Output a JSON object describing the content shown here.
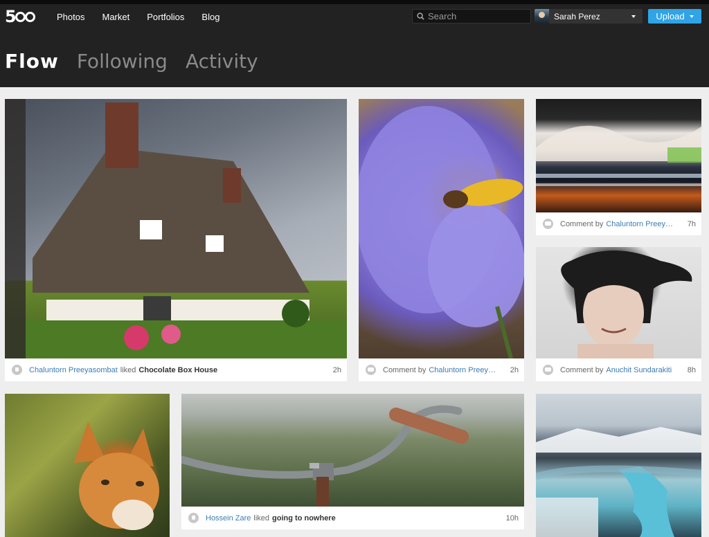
{
  "header": {
    "logo": "5",
    "nav": [
      "Photos",
      "Market",
      "Portfolios",
      "Blog"
    ],
    "search": {
      "placeholder": "Search",
      "icon": "search-icon"
    },
    "user": {
      "name": "Sarah Perez"
    },
    "upload_label": "Upload"
  },
  "tabs": [
    "Flow",
    "Following",
    "Activity"
  ],
  "active_tab": "Flow",
  "cards": [
    {
      "photo": "cottage",
      "icon": "like-icon",
      "who": "Chaluntorn Preeyasombat",
      "verb": "liked",
      "what": "Chocolate Box House",
      "time": "2h"
    },
    {
      "photo": "flower",
      "icon": "comment-icon",
      "verb": "Comment by",
      "who": "Chaluntorn Preeyas...",
      "time": "2h"
    },
    {
      "photo": "night-river",
      "icon": "comment-icon",
      "verb": "Comment by",
      "who": "Chaluntorn Preeyas...",
      "time": "7h"
    },
    {
      "photo": "child",
      "icon": "comment-icon",
      "verb": "Comment by",
      "who": "Anuchit Sundarakiti",
      "time": "8h"
    },
    {
      "photo": "fox"
    },
    {
      "photo": "bicycle",
      "icon": "like-icon",
      "who": "Hossein Zare",
      "verb": "liked",
      "what": "going to nowhere",
      "time": "10h"
    },
    {
      "photo": "glacier-river"
    }
  ]
}
